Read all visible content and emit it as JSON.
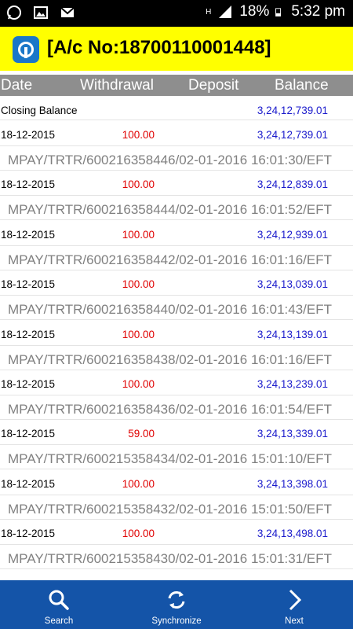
{
  "status_bar": {
    "battery": "18%",
    "time": "5:32 pm",
    "network_label": "H"
  },
  "app_bar": {
    "account_title": "[A/c No:18700110001448]"
  },
  "columns": [
    "Date",
    "Withdrawal",
    "Deposit",
    "Balance"
  ],
  "closing": {
    "label": "Closing Balance",
    "balance": "3,24,12,739.01"
  },
  "transactions": [
    {
      "date": "18-12-2015",
      "withdrawal": "100.00",
      "balance": "3,24,12,739.01",
      "narration": "MPAY/TRTR/600216358446/02-01-2016 16:01:30/EFT"
    },
    {
      "date": "18-12-2015",
      "withdrawal": "100.00",
      "balance": "3,24,12,839.01",
      "narration": "MPAY/TRTR/600216358444/02-01-2016 16:01:52/EFT"
    },
    {
      "date": "18-12-2015",
      "withdrawal": "100.00",
      "balance": "3,24,12,939.01",
      "narration": "MPAY/TRTR/600216358442/02-01-2016 16:01:16/EFT"
    },
    {
      "date": "18-12-2015",
      "withdrawal": "100.00",
      "balance": "3,24,13,039.01",
      "narration": "MPAY/TRTR/600216358440/02-01-2016 16:01:43/EFT"
    },
    {
      "date": "18-12-2015",
      "withdrawal": "100.00",
      "balance": "3,24,13,139.01",
      "narration": "MPAY/TRTR/600216358438/02-01-2016 16:01:16/EFT"
    },
    {
      "date": "18-12-2015",
      "withdrawal": "100.00",
      "balance": "3,24,13,239.01",
      "narration": "MPAY/TRTR/600216358436/02-01-2016 16:01:54/EFT"
    },
    {
      "date": "18-12-2015",
      "withdrawal": "59.00",
      "balance": "3,24,13,339.01",
      "narration": "MPAY/TRTR/600215358434/02-01-2016 15:01:10/EFT"
    },
    {
      "date": "18-12-2015",
      "withdrawal": "100.00",
      "balance": "3,24,13,398.01",
      "narration": "MPAY/TRTR/600215358432/02-01-2016 15:01:50/EFT"
    },
    {
      "date": "18-12-2015",
      "withdrawal": "100.00",
      "balance": "3,24,13,498.01",
      "narration": "MPAY/TRTR/600215358430/02-01-2016 15:01:31/EFT"
    }
  ],
  "bottom_nav": [
    {
      "label": "Search",
      "icon": "search-icon"
    },
    {
      "label": "Synchronize",
      "icon": "sync-icon"
    },
    {
      "label": "Next",
      "icon": "chevron-right-icon"
    }
  ],
  "colors": {
    "app_bar": "#ffff00",
    "header": "#8e8e8e",
    "withdrawal": "#e00000",
    "balance": "#1a1acc",
    "bottom_bar": "#1454a8"
  }
}
